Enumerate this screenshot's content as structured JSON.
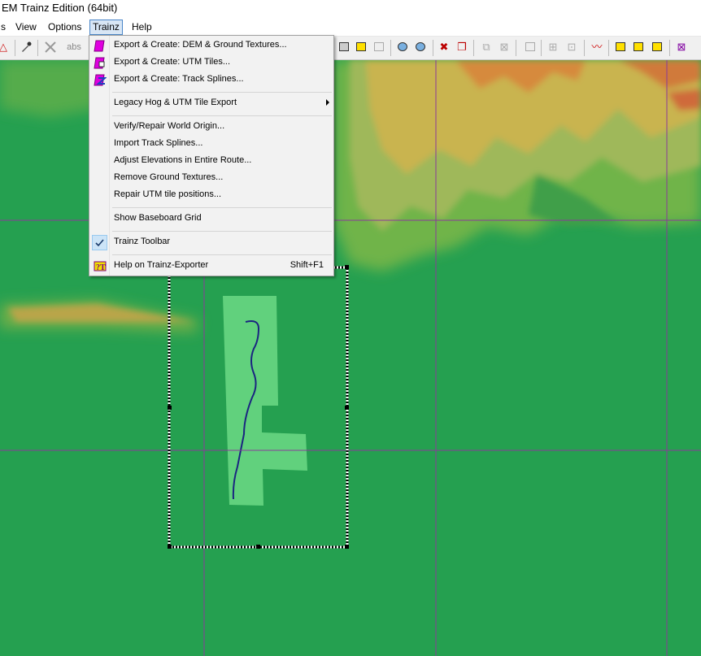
{
  "window": {
    "title": "EM Trainz Edition (64bit)"
  },
  "menubar": {
    "items": [
      {
        "label": "s"
      },
      {
        "label": "View"
      },
      {
        "label": "Options"
      },
      {
        "label": "Trainz"
      },
      {
        "label": "Help"
      }
    ]
  },
  "toolbar": {
    "abs_label": "abs"
  },
  "trainz_menu": {
    "items": [
      {
        "label": "Export & Create: DEM & Ground Textures..."
      },
      {
        "label": "Export & Create: UTM Tiles..."
      },
      {
        "label": "Export & Create: Track Splines..."
      },
      {
        "label": "Legacy Hog & UTM Tile Export"
      },
      {
        "label": "Verify/Repair World Origin..."
      },
      {
        "label": "Import Track Splines..."
      },
      {
        "label": "Adjust Elevations in Entire Route..."
      },
      {
        "label": "Remove Ground Textures..."
      },
      {
        "label": "Repair UTM tile positions..."
      },
      {
        "label": "Show Baseboard Grid"
      },
      {
        "label": "Trainz Toolbar",
        "checked": true
      },
      {
        "label": "Help on Trainz-Exporter",
        "shortcut": "Shift+F1"
      }
    ]
  },
  "colors": {
    "accent": "#cc00cc",
    "grid": "#8a3a9a",
    "terrain_low": "#25a050",
    "terrain_high": "#d07a3a"
  }
}
